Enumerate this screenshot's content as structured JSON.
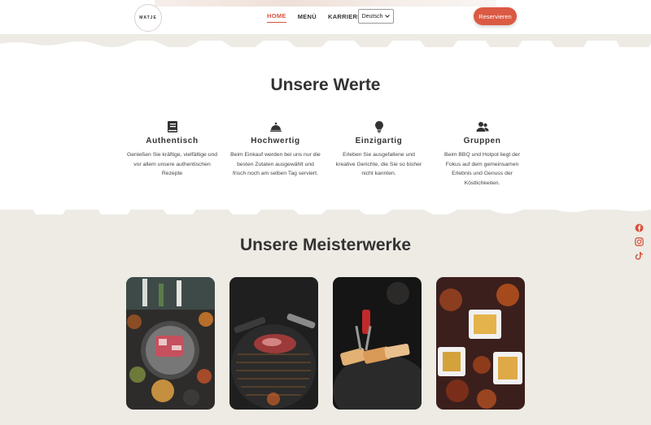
{
  "header": {
    "logo_text": "MATJE",
    "nav": [
      "HOME",
      "MENÜ",
      "KARRIERE"
    ],
    "active_nav": "HOME",
    "language": "Deutsch",
    "reserve_label": "Reservieren",
    "accent_color": "#db5a43"
  },
  "werte": {
    "title": "Unsere Werte",
    "items": [
      {
        "icon": "book-icon",
        "title": "Authentisch",
        "text": "Genießen Sie kräftige, vielfältige und vor allem unsere authentischen Rezepte"
      },
      {
        "icon": "cloche-icon",
        "title": "Hochwertig",
        "text": "Beim Einkauf werden bei uns nur die besten Zutaten ausgewählt und frisch noch am selben Tag serviert."
      },
      {
        "icon": "lightbulb-icon",
        "title": "Einzigartig",
        "text": "Erleben Sie ausgefallene und kreative Gerichte, die Sie so bisher nicht kannten."
      },
      {
        "icon": "users-icon",
        "title": "Gruppen",
        "text": "Beim BBQ und Hotpot liegt der Fokus auf dem gemeinsamen Erlebnis und Genuss der Köstlichkeiten."
      }
    ]
  },
  "meisterwerke": {
    "title": "Unsere Meisterwerke",
    "images": [
      "korean-bbq-table-photo",
      "grill-meat-photo",
      "grilled-pork-belly-photo",
      "fried-chicken-fries-photo"
    ]
  },
  "social": [
    "facebook-icon",
    "instagram-icon",
    "tiktok-icon"
  ]
}
